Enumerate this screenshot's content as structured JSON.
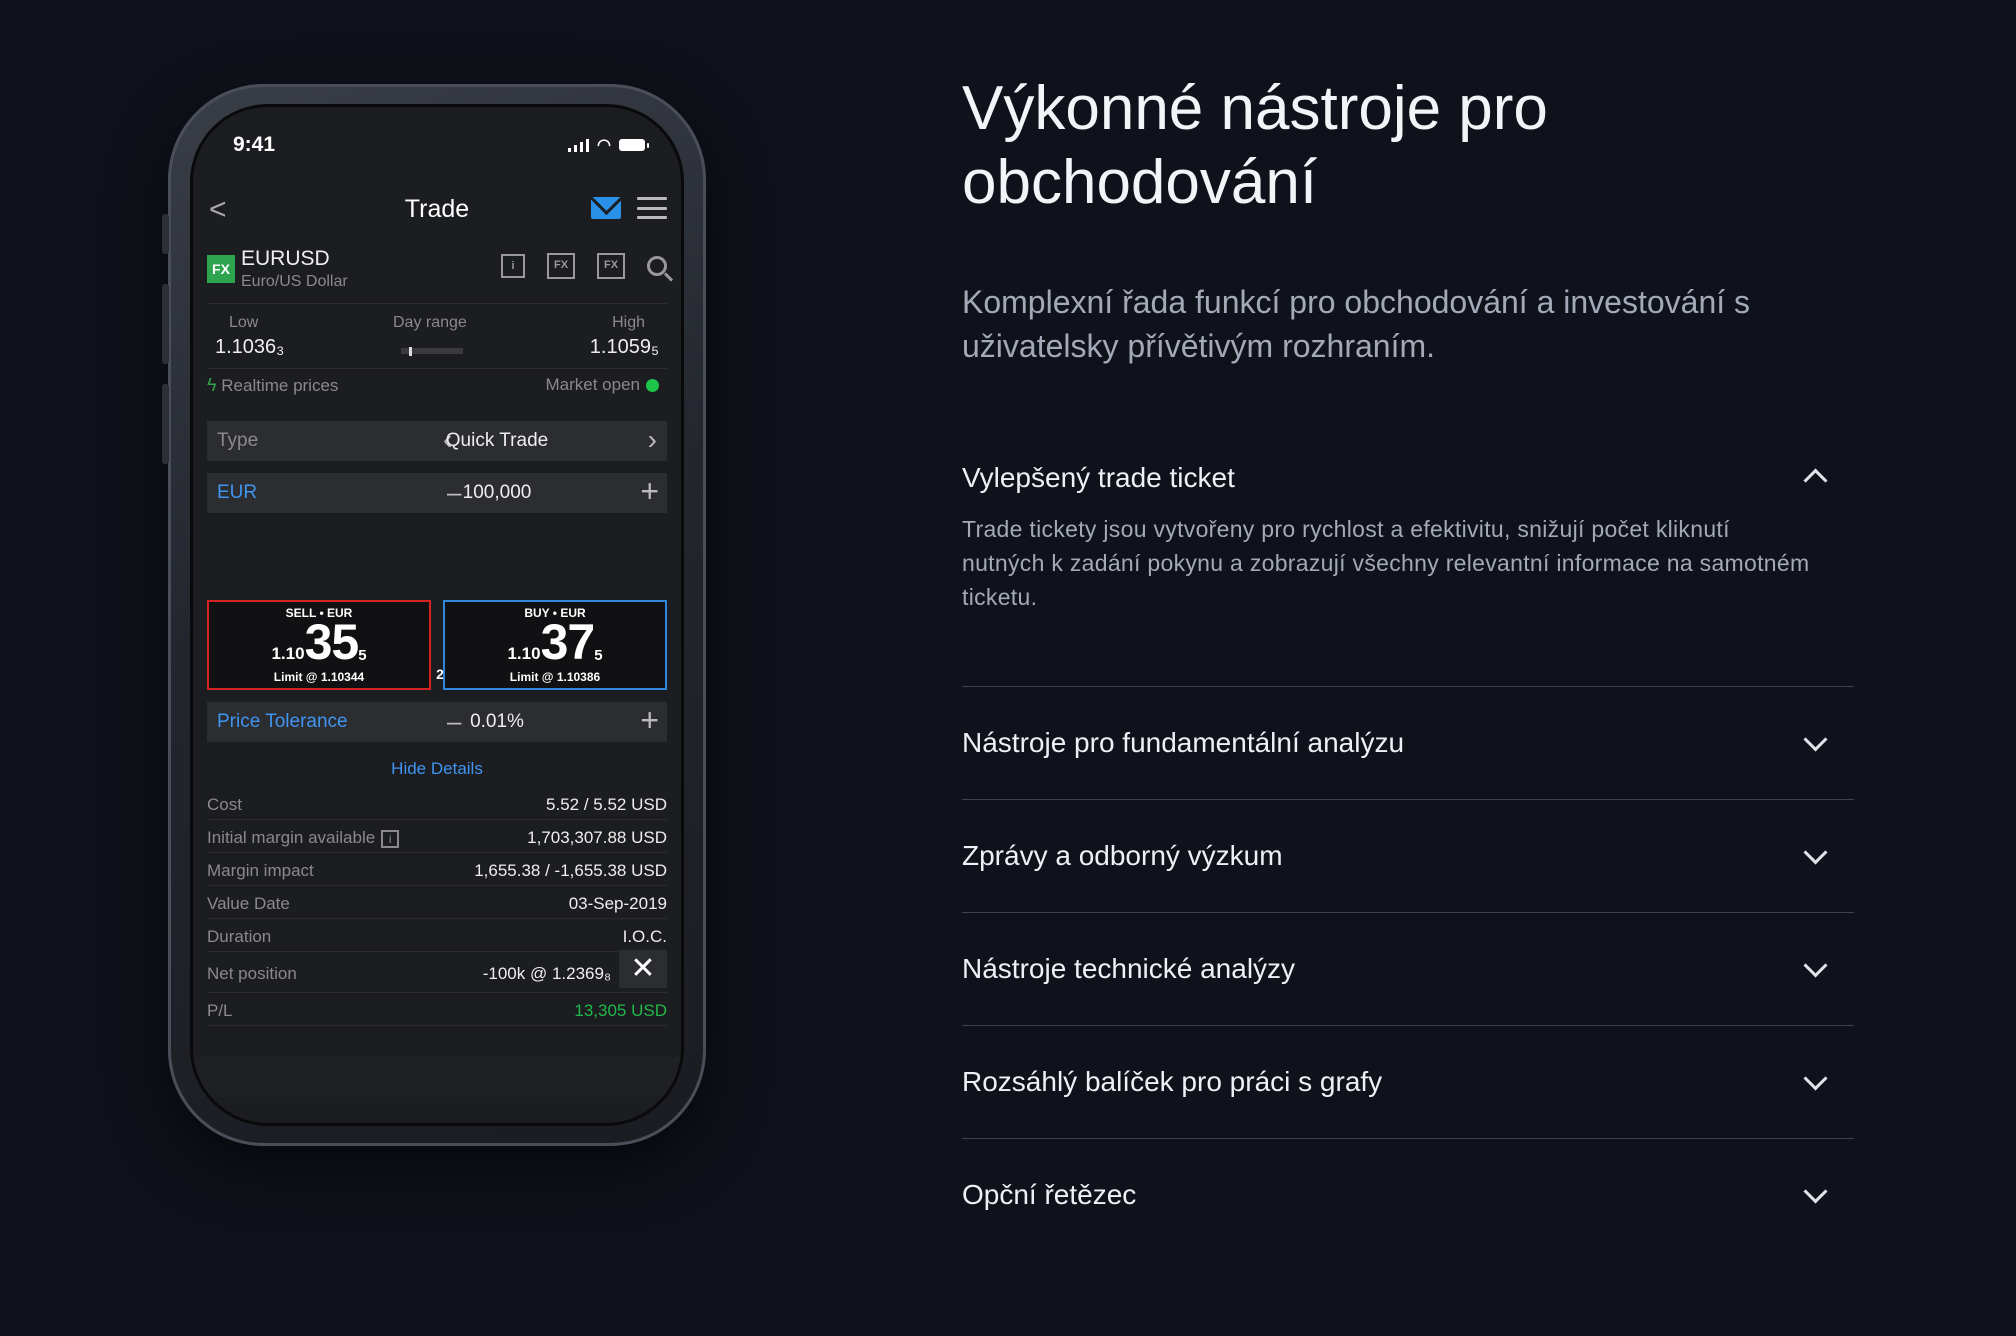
{
  "phone": {
    "status": {
      "time": "9:41"
    },
    "nav": {
      "back": "<",
      "title": "Trade"
    },
    "instrument": {
      "badge": "FX",
      "symbol": "EURUSD",
      "name": "Euro/US Dollar",
      "icon1": "i",
      "icon2": "FX",
      "icon3": "FX"
    },
    "range": {
      "low_label": "Low",
      "low_value": "1.1036₃",
      "day_range_label": "Day range",
      "high_label": "High",
      "high_value": "1.1059₅",
      "realtime": "Realtime prices",
      "market": "Market open"
    },
    "type_row": {
      "label": "Type",
      "value": "Quick Trade"
    },
    "amount_row": {
      "label": "EUR",
      "value": "100,000"
    },
    "sell": {
      "header": "SELL • EUR",
      "big_prefix": "1.10",
      "big": "35",
      "pip": "5",
      "limit": "Limit @ 1.10344"
    },
    "buy": {
      "header": "BUY • EUR",
      "big_prefix": "1.10",
      "big": "37",
      "pip": "5",
      "limit": "Limit @ 1.10386"
    },
    "spread": "2",
    "tolerance_row": {
      "label": "Price Tolerance",
      "value": "0.01%"
    },
    "hide_details": "Hide Details",
    "details": [
      {
        "k": "Cost",
        "v": "5.52 / 5.52 USD"
      },
      {
        "k": "Initial margin available",
        "v": "1,703,307.88 USD"
      },
      {
        "k": "Margin impact",
        "v": "1,655.38 / -1,655.38 USD"
      },
      {
        "k": "Value Date",
        "v": "03-Sep-2019"
      },
      {
        "k": "Duration",
        "v": "I.O.C."
      },
      {
        "k": "Net position",
        "v": "-100k @ 1.2369₈"
      },
      {
        "k": "P/L",
        "v": "13,305 USD"
      }
    ]
  },
  "hero": {
    "title": "Výkonné nástroje pro obchodování",
    "subtitle": "Komplexní řada funkcí pro obchodování a investování s uživatelsky přívětivým rozhraním."
  },
  "accordion": [
    {
      "title": "Vylepšený trade ticket",
      "body": "Trade tickety jsou vytvořeny pro rychlost a efektivitu, snižují počet kliknutí nutných k zadání pokynu a zobrazují všechny relevantní informace na samotném ticketu."
    },
    {
      "title": "Nástroje pro fundamentální analýzu"
    },
    {
      "title": "Zprávy a odborný výzkum"
    },
    {
      "title": "Nástroje technické analýzy"
    },
    {
      "title": "Rozsáhlý balíček pro práci s grafy"
    },
    {
      "title": "Opční řetězec"
    }
  ],
  "colors": {
    "background": "#0f121a",
    "sell": "#d32424",
    "buy": "#2e86de",
    "positive": "#1fb84a",
    "link": "#3f95ef"
  }
}
